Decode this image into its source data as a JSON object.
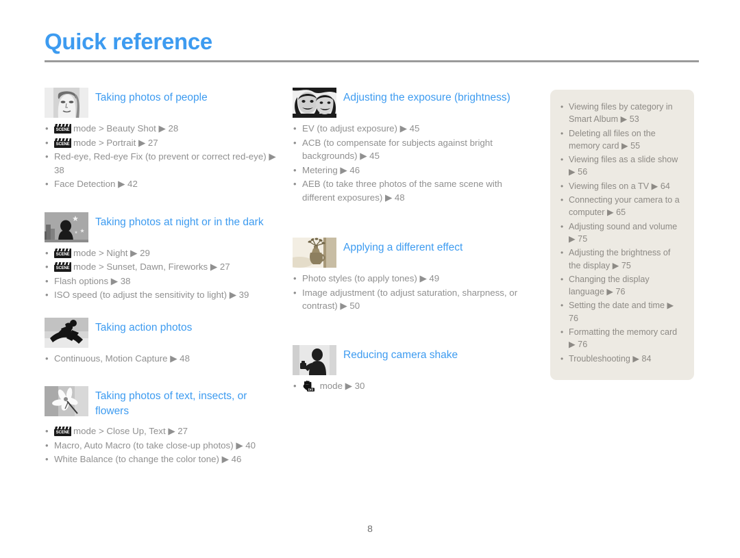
{
  "page": {
    "title": "Quick reference",
    "folio": "8",
    "accent_color": "#3d9bf0",
    "body_text_color": "#909090",
    "sidepanel_bg": "#edeae3",
    "rule_color": "#9a9a9a"
  },
  "columns": {
    "left": [
      {
        "thumb_name": "thumb-portrait-woman",
        "title": "Taking photos of people",
        "items": [
          {
            "icon": "scene-mode-icon",
            "text": "mode > Beauty Shot ▶ 28"
          },
          {
            "icon": "scene-mode-icon",
            "text": "mode > Portrait ▶ 27"
          },
          {
            "icon": null,
            "text": "Red-eye, Red-eye Fix (to prevent or correct red-eye) ▶ 38"
          },
          {
            "icon": null,
            "text": "Face Detection ▶ 42"
          }
        ]
      },
      {
        "thumb_name": "thumb-night-scene",
        "title": "Taking photos at night or in the dark",
        "items": [
          {
            "icon": "scene-mode-icon",
            "text": "mode > Night ▶ 29"
          },
          {
            "icon": "scene-mode-icon",
            "text": "mode > Sunset, Dawn, Fireworks ▶ 27"
          },
          {
            "icon": null,
            "text": "Flash options ▶ 38"
          },
          {
            "icon": null,
            "text": "ISO speed (to adjust the sensitivity to light) ▶ 39"
          }
        ]
      },
      {
        "thumb_name": "thumb-snowboarder",
        "title": "Taking action photos",
        "items": [
          {
            "icon": null,
            "text": "Continuous, Motion Capture ▶ 48"
          }
        ]
      },
      {
        "thumb_name": "thumb-flower",
        "title": "Taking photos of text, insects, or flowers",
        "items": [
          {
            "icon": "scene-mode-icon",
            "text": "mode > Close Up, Text ▶ 27"
          },
          {
            "icon": null,
            "text": "Macro, Auto Macro (to take close-up photos) ▶ 40"
          },
          {
            "icon": null,
            "text": "White Balance (to change the color tone) ▶ 46"
          }
        ]
      }
    ],
    "middle": [
      {
        "thumb_name": "thumb-two-faces",
        "title": "Adjusting the exposure (brightness)",
        "items": [
          {
            "icon": null,
            "text": "EV (to adjust exposure) ▶ 45"
          },
          {
            "icon": null,
            "text": "ACB (to compensate for subjects against bright backgrounds) ▶ 45"
          },
          {
            "icon": null,
            "text": "Metering ▶ 46"
          },
          {
            "icon": null,
            "text": "AEB (to take three photos of the same scene with different exposures) ▶ 48"
          }
        ]
      },
      {
        "thumb_name": "thumb-vase-sepia",
        "title": "Applying a different effect",
        "items": [
          {
            "icon": null,
            "text": "Photo styles (to apply tones) ▶ 49"
          },
          {
            "icon": null,
            "text": "Image adjustment (to adjust saturation, sharpness, or contrast) ▶ 50"
          }
        ]
      },
      {
        "thumb_name": "thumb-person-camera",
        "title": "Reducing camera shake",
        "items": [
          {
            "icon": "dis-mode-icon",
            "text": "mode ▶ 30"
          }
        ]
      }
    ]
  },
  "sidepanel": {
    "items": [
      "Viewing files by category in Smart Album ▶ 53",
      "Deleting all files on the memory card ▶ 55",
      "Viewing files as a slide show ▶ 56",
      "Viewing files on a TV ▶ 64",
      "Connecting your camera to a computer ▶ 65",
      "Adjusting sound and volume ▶ 75",
      "Adjusting the brightness of the display ▶ 75",
      "Changing the display language ▶ 76",
      "Setting the date and time ▶ 76",
      "Formatting the memory card ▶ 76",
      "Troubleshooting ▶ 84"
    ]
  },
  "icon_labels": {
    "scene": "SCENE",
    "dis": "DIS"
  }
}
